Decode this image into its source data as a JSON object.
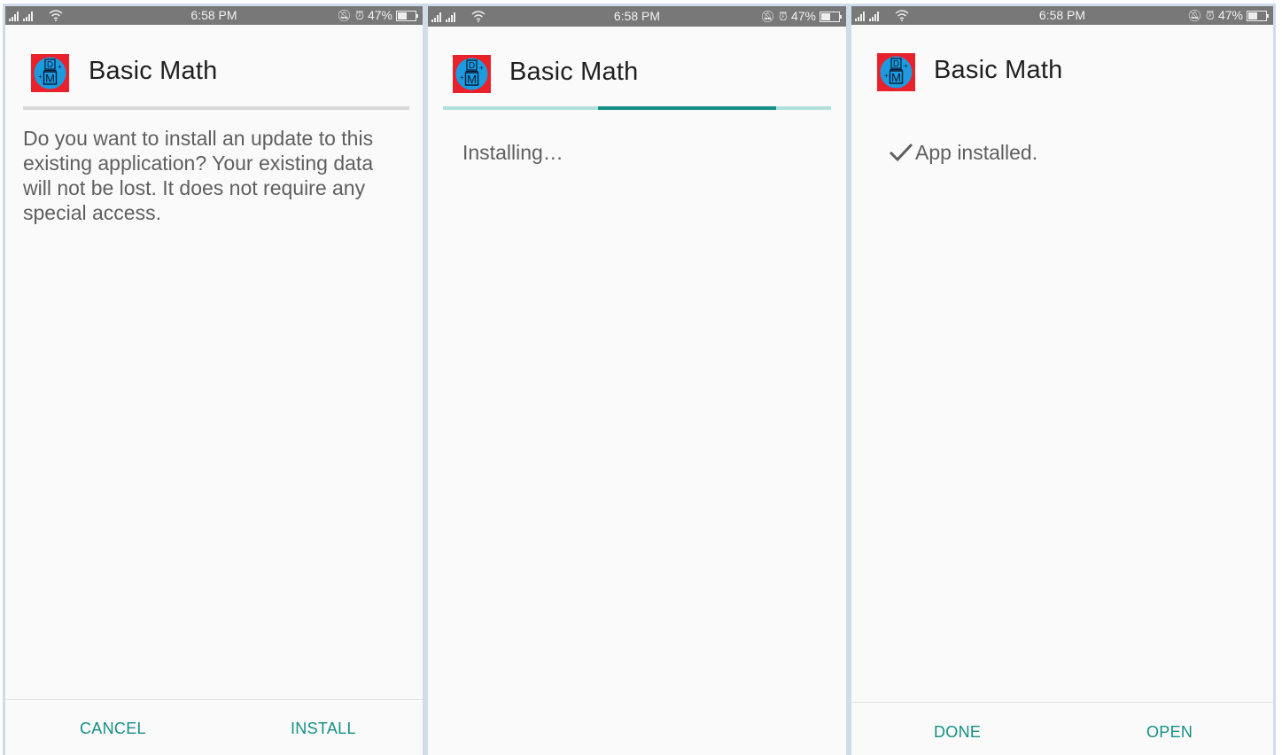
{
  "status_bar": {
    "time": "6:58 PM",
    "battery": "47%"
  },
  "app": {
    "name": "Basic Math",
    "icon_letters": [
      "D",
      "M"
    ]
  },
  "screens": [
    {
      "message": "Do you want to install an update to this existing application? Your existing data will not be lost. It does not require any special access.",
      "buttons": {
        "left": "CANCEL",
        "right": "INSTALL"
      }
    },
    {
      "message": "Installing…",
      "progress": 0.46
    },
    {
      "message": "App installed.",
      "buttons": {
        "left": "DONE",
        "right": "OPEN"
      }
    }
  ],
  "colors": {
    "accent": "#148f86",
    "progress_track": "#b2dfdb",
    "status_bar": "#787878",
    "icon_bg": "#e8212b",
    "icon_circle": "#1b9ce0"
  }
}
